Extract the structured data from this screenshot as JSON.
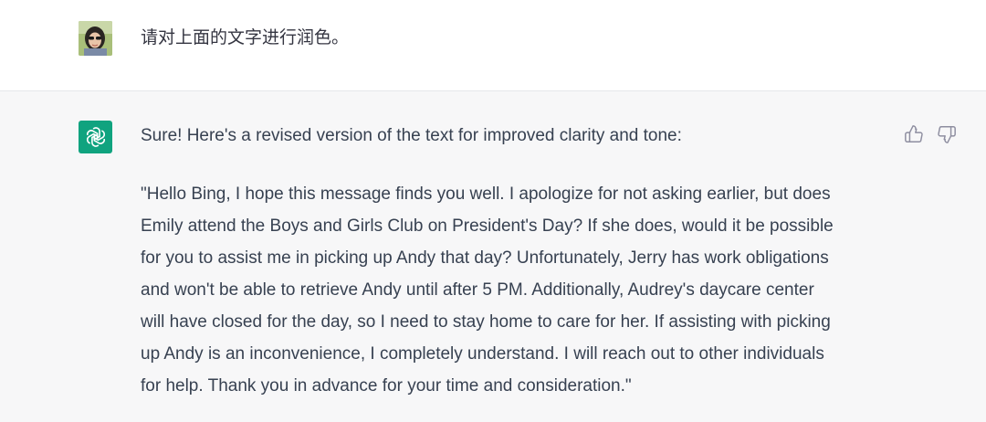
{
  "user_message": {
    "text": "请对上面的文字进行润色。"
  },
  "assistant_message": {
    "intro": "Sure! Here's a revised version of the text for improved clarity and tone:",
    "body_lines": [
      "\"Hello Bing, I hope this message finds you well. I apologize for not asking earlier, but does",
      "Emily attend the Boys and Girls Club on President's Day? If she does, would it be possible",
      "for you to assist me in picking up Andy that day? Unfortunately, Jerry has work obligations",
      "and won't be able to retrieve Andy until after 5 PM. Additionally, Audrey's daycare center",
      "will have closed for the day, so I need to stay home to care for her. If assisting with picking",
      "up Andy is an inconvenience, I completely understand. I will reach out to other individuals",
      "for help. Thank you in advance for your time and consideration.\""
    ]
  },
  "icons": {
    "gpt_logo": "openai-logo-icon",
    "thumb_up": "thumbs-up-icon",
    "thumb_down": "thumbs-down-icon"
  },
  "colors": {
    "gpt_brand": "#10a37f",
    "assistant_bg": "#f7f7f8",
    "text": "#374151"
  }
}
